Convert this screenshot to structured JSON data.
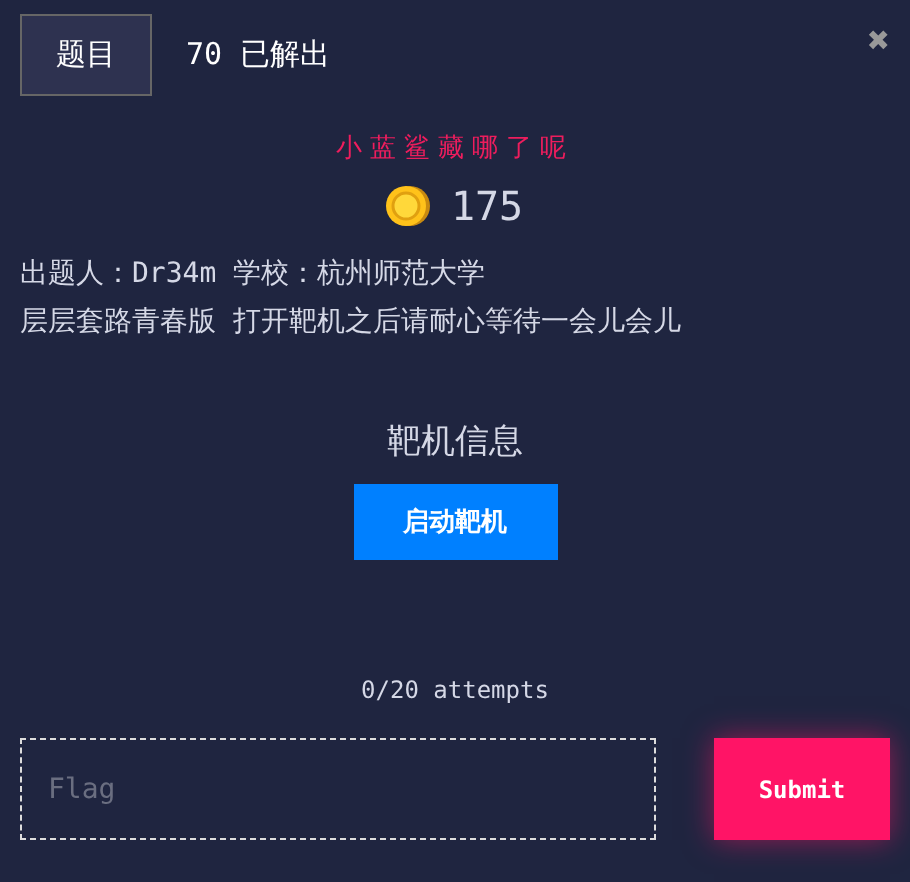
{
  "tabs": [
    {
      "label": "题目",
      "selected": true
    }
  ],
  "solved": "70 已解出",
  "close": "✖",
  "challenge": {
    "title": "小蓝鲨藏哪了呢",
    "points": "175",
    "author_line": "出题人：Dr34m 学校：杭州师范大学",
    "description": "层层套路青春版 打开靶机之后请耐心等待一会儿会儿"
  },
  "target": {
    "heading": "靶机信息",
    "button": "启动靶机"
  },
  "attempts": "0/20 attempts",
  "flag": {
    "placeholder": "Flag"
  },
  "submit": "Submit"
}
